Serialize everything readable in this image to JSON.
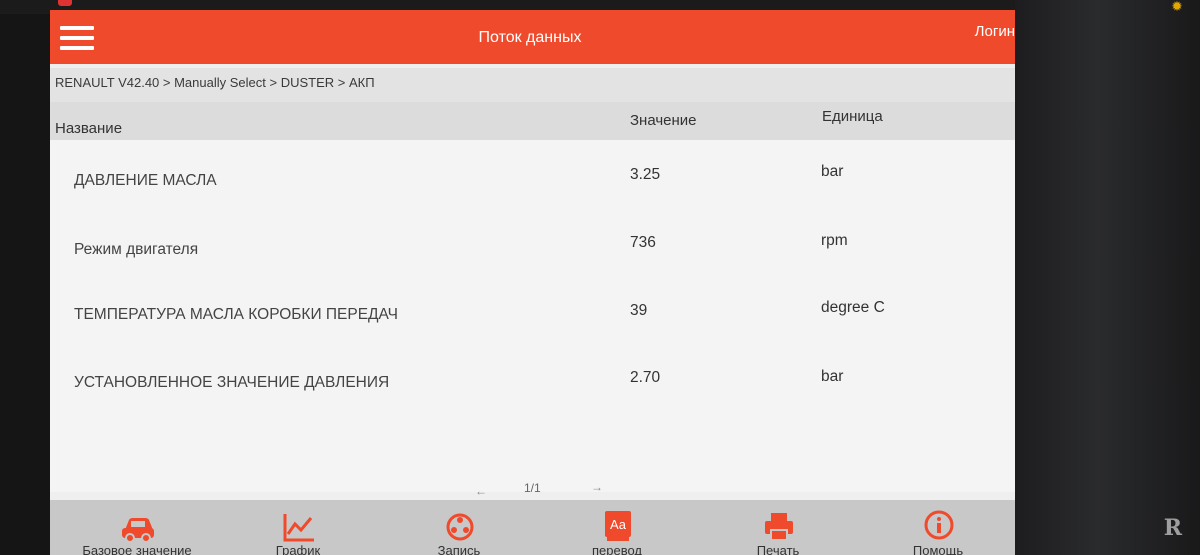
{
  "header": {
    "title": "Поток данных",
    "login_label": "Логин"
  },
  "breadcrumb": "RENAULT V42.40 > Manually Select > DUSTER > АКП",
  "columns": {
    "name": "Название",
    "value": "Значение",
    "unit": "Единица"
  },
  "rows": [
    {
      "name": "ДАВЛЕНИЕ МАСЛА",
      "value": "3.25",
      "unit": "bar"
    },
    {
      "name": "Режим двигателя",
      "value": "736",
      "unit": "rpm"
    },
    {
      "name": "ТЕМПЕРАТУРА МАСЛА КОРОБКИ ПЕРЕДАЧ",
      "value": "39",
      "unit": "degree C"
    },
    {
      "name": "УСТАНОВЛЕННОЕ ЗНАЧЕНИЕ ДАВЛЕНИЯ",
      "value": "2.70",
      "unit": "bar"
    }
  ],
  "pager": {
    "prev": "←",
    "page": "1/1",
    "next": "→"
  },
  "toolbar": [
    {
      "label": "Базовое значение",
      "icon": "car-icon"
    },
    {
      "label": "График",
      "icon": "chart-icon"
    },
    {
      "label": "Запись",
      "icon": "record-icon"
    },
    {
      "label": "перевод",
      "icon": "translate-icon"
    },
    {
      "label": "Печать",
      "icon": "print-icon"
    },
    {
      "label": "Помощь",
      "icon": "help-icon"
    }
  ],
  "colors": {
    "accent": "#ef4a2c",
    "toolbar_bg": "#c8c8c8"
  }
}
